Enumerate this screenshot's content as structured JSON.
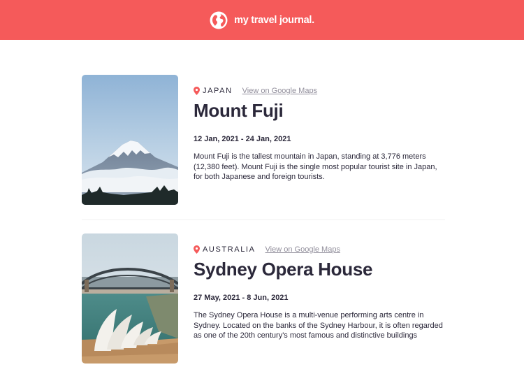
{
  "header": {
    "brand": "my travel journal."
  },
  "entries": [
    {
      "country": "JAPAN",
      "maps_link": "View on Google Maps",
      "title": "Mount Fuji",
      "dates": "12 Jan, 2021 - 24 Jan, 2021",
      "description": "Mount Fuji is the tallest mountain in Japan, standing at 3,776 meters (12,380 feet). Mount Fuji is the single most popular tourist site in Japan, for both Japanese and foreign tourists."
    },
    {
      "country": "AUSTRALIA",
      "maps_link": "View on Google Maps",
      "title": "Sydney Opera House",
      "dates": "27 May, 2021 - 8 Jun, 2021",
      "description": "The Sydney Opera House is a multi-venue performing arts centre in Sydney. Located on the banks of the Sydney Harbour, it is often regarded as one of the 20th century's most famous and distinctive buildings"
    }
  ],
  "colors": {
    "header_bg": "#F55A5A",
    "text_dark": "#2B283A",
    "link_gray": "#918E9B",
    "pin": "#F55A5A"
  },
  "icons": {
    "logo": "globe-icon",
    "location": "map-pin-icon"
  }
}
